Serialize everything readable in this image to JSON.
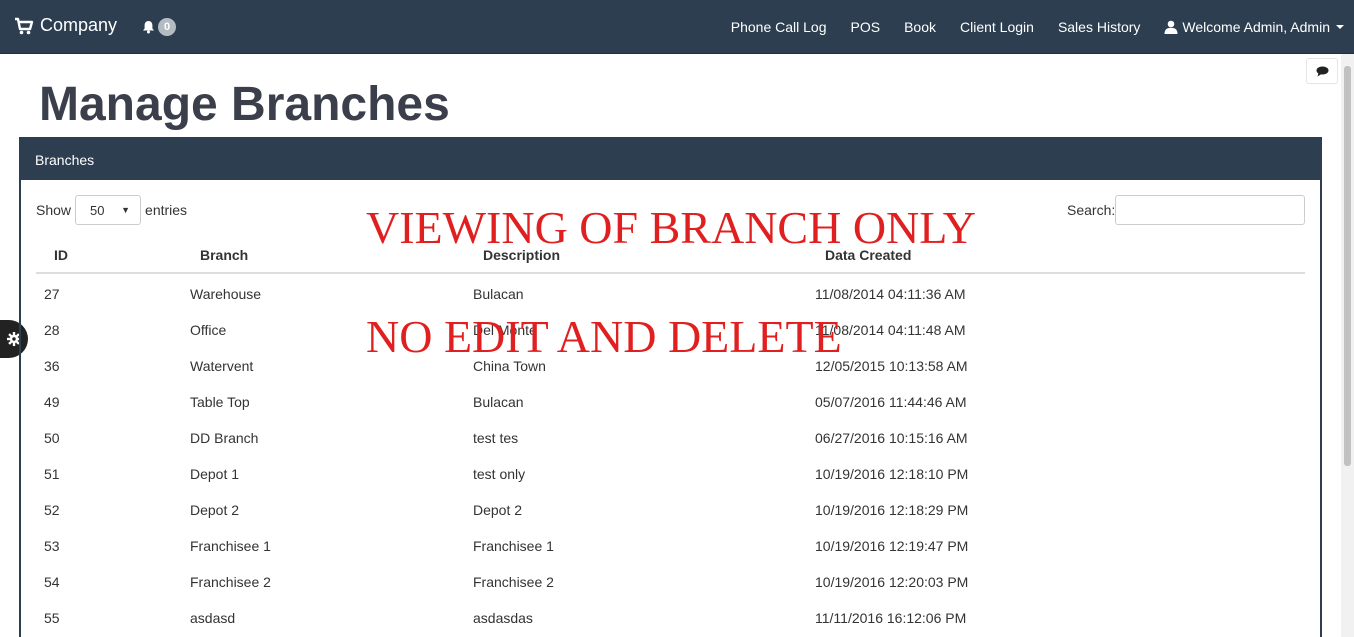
{
  "navbar": {
    "brand": "Company",
    "notification_count": "0",
    "links": [
      "Phone Call Log",
      "POS",
      "Book",
      "Client Login",
      "Sales History"
    ],
    "user_label": "Welcome Admin, Admin"
  },
  "page": {
    "title": "Manage Branches"
  },
  "panel": {
    "heading": "Branches",
    "show_label": "Show",
    "entries_value": "50",
    "entries_label": "entries",
    "search_label": "Search:",
    "search_value": ""
  },
  "overlay": {
    "line1": "VIEWING OF BRANCH ONLY",
    "line2": "NO EDIT AND DELETE"
  },
  "table": {
    "columns": [
      "ID",
      "Branch",
      "Description",
      "Data Created"
    ],
    "rows": [
      [
        "27",
        "Warehouse",
        "Bulacan",
        "11/08/2014 04:11:36 AM"
      ],
      [
        "28",
        "Office",
        "Del Monte",
        "11/08/2014 04:11:48 AM"
      ],
      [
        "36",
        "Watervent",
        "China Town",
        "12/05/2015 10:13:58 AM"
      ],
      [
        "49",
        "Table Top",
        "Bulacan",
        "05/07/2016 11:44:46 AM"
      ],
      [
        "50",
        "DD Branch",
        "test tes",
        "06/27/2016 10:15:16 AM"
      ],
      [
        "51",
        "Depot 1",
        "test only",
        "10/19/2016 12:18:10 PM"
      ],
      [
        "52",
        "Depot 2",
        "Depot 2",
        "10/19/2016 12:18:29 PM"
      ],
      [
        "53",
        "Franchisee 1",
        "Franchisee 1",
        "10/19/2016 12:19:47 PM"
      ],
      [
        "54",
        "Franchisee 2",
        "Franchisee 2",
        "10/19/2016 12:20:03 PM"
      ],
      [
        "55",
        "asdasd",
        "asdasdas",
        "11/11/2016 16:12:06 PM"
      ]
    ]
  },
  "colors": {
    "navbar": "#2c3e50",
    "overlay_text": "#e02020",
    "title": "#3a3f4b"
  }
}
